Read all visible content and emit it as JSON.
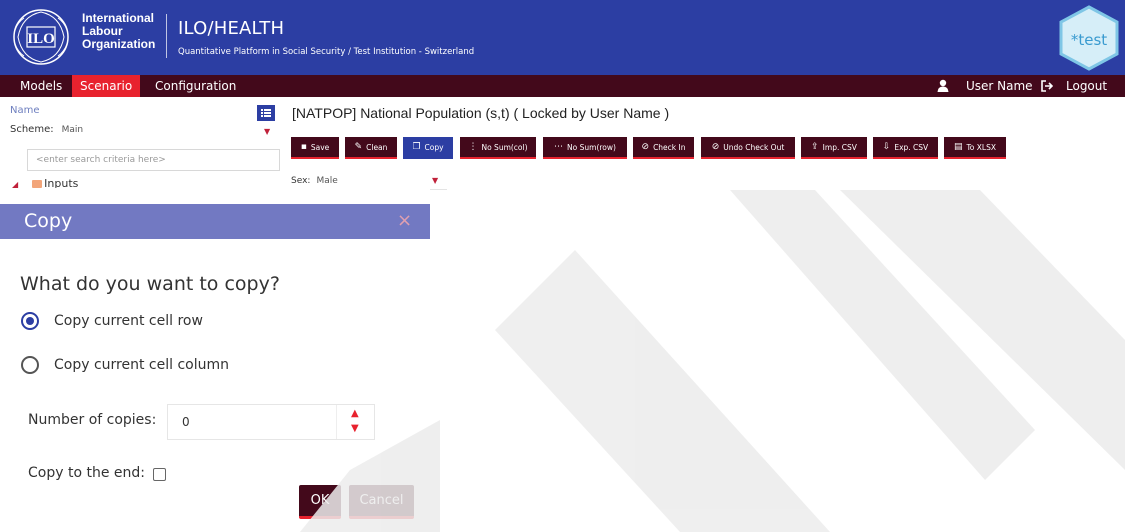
{
  "header": {
    "org_lines": [
      "International",
      "Labour",
      "Organization"
    ],
    "app_title": "ILO/HEALTH",
    "subtitle": "Quantitative Platform in Social Security / Test Institution - Switzerland",
    "badge": "*test",
    "logo_icon": "ilo-logo-icon",
    "colors": {
      "primary": "#2c3ea3",
      "nav": "#43091b",
      "accent": "#e8222e"
    }
  },
  "nav": {
    "items": [
      {
        "label": "Models",
        "active": false
      },
      {
        "label": "Scenario",
        "active": true
      },
      {
        "label": "Configuration",
        "active": false
      }
    ],
    "user_name": "User Name",
    "logout": "Logout"
  },
  "left_panel": {
    "name_label": "Name",
    "scheme_label": "Scheme:",
    "scheme_value": "Main",
    "search_placeholder": "<enter search criteria here>",
    "tree_item": "Inputs"
  },
  "main": {
    "title": "[NATPOP] National Population (s,t) ( Locked by User Name )",
    "toolbar": [
      {
        "label": "Save",
        "icon": "save-icon",
        "active": false
      },
      {
        "label": "Clean",
        "icon": "clean-icon",
        "active": false
      },
      {
        "label": "Copy",
        "icon": "copy-icon",
        "active": true
      },
      {
        "label": "No Sum(col)",
        "icon": "column-icon",
        "active": false
      },
      {
        "label": "No Sum(row)",
        "icon": "row-icon",
        "active": false
      },
      {
        "label": "Check In",
        "icon": "check-icon",
        "active": false
      },
      {
        "label": "Undo Check Out",
        "icon": "undo-icon",
        "active": false
      },
      {
        "label": "Imp. CSV",
        "icon": "import-icon",
        "active": false
      },
      {
        "label": "Exp. CSV",
        "icon": "export-icon",
        "active": false
      },
      {
        "label": "To XLSX",
        "icon": "xlsx-icon",
        "active": false
      }
    ],
    "sex_label": "Sex:",
    "sex_value": "Male"
  },
  "dialog": {
    "title": "Copy",
    "close_icon": "×",
    "question": "What do you want to copy?",
    "option_row": "Copy current cell row",
    "option_column": "Copy current cell column",
    "selected": "row",
    "copies_label": "Number of copies:",
    "copies_value": "0",
    "end_label": "Copy to the end:",
    "ok": "OK",
    "cancel": "Cancel"
  }
}
